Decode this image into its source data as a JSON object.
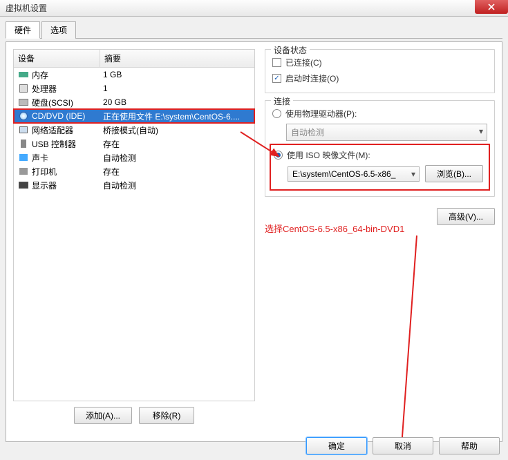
{
  "window": {
    "title": "虚拟机设置"
  },
  "tabs": {
    "hardware": "硬件",
    "options": "选项"
  },
  "hw_header": {
    "device": "设备",
    "summary": "摘要"
  },
  "hw_rows": [
    {
      "icon": "ico-mem",
      "name": "内存",
      "summary": "1 GB"
    },
    {
      "icon": "ico-cpu",
      "name": "处理器",
      "summary": "1"
    },
    {
      "icon": "ico-disk",
      "name": "硬盘(SCSI)",
      "summary": "20 GB"
    },
    {
      "icon": "ico-cd",
      "name": "CD/DVD (IDE)",
      "summary": "正在使用文件 E:\\system\\CentOS-6...."
    },
    {
      "icon": "ico-net",
      "name": "网络适配器",
      "summary": "桥接模式(自动)"
    },
    {
      "icon": "ico-usb",
      "name": "USB 控制器",
      "summary": "存在"
    },
    {
      "icon": "ico-snd",
      "name": "声卡",
      "summary": "自动检测"
    },
    {
      "icon": "ico-prn",
      "name": "打印机",
      "summary": "存在"
    },
    {
      "icon": "ico-disp",
      "name": "显示器",
      "summary": "自动检测"
    }
  ],
  "buttons": {
    "add": "添加(A)...",
    "remove": "移除(R)",
    "advanced": "高级(V)...",
    "browse": "浏览(B)...",
    "ok": "确定",
    "cancel": "取消",
    "help": "帮助"
  },
  "groups": {
    "status": {
      "legend": "设备状态",
      "connected": "已连接(C)",
      "connect_on_start": "启动时连接(O)"
    },
    "connection": {
      "legend": "连接",
      "use_physical": "使用物理驱动器(P):",
      "autodetect": "自动检测",
      "use_iso": "使用 ISO 映像文件(M):",
      "iso_path": "E:\\system\\CentOS-6.5-x86_"
    }
  },
  "annotation": "选择CentOS-6.5-x86_64-bin-DVD1"
}
